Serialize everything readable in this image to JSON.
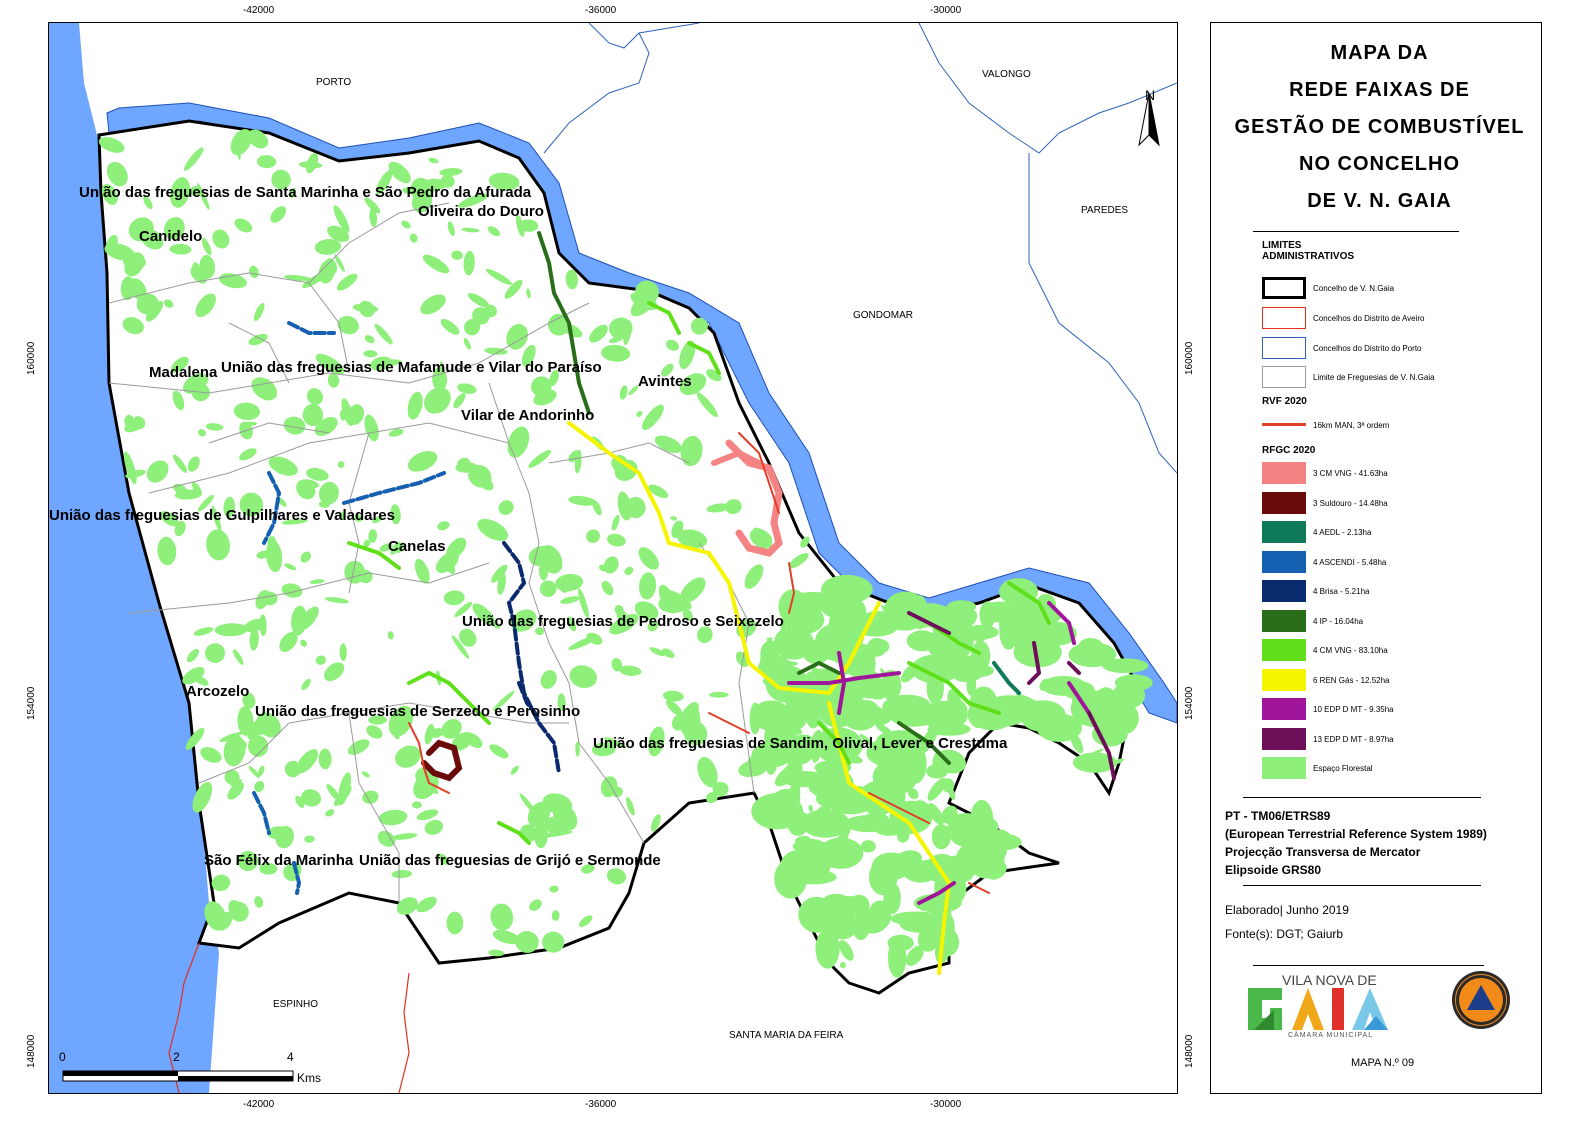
{
  "title": {
    "lines": [
      "MAPA DA",
      "REDE FAIXAS DE",
      "GESTÃO DE COMBUSTÍVEL",
      "NO CONCELHO",
      "DE V. N. GAIA"
    ]
  },
  "axes": {
    "x_ticks": [
      "-42000",
      "-36000",
      "-30000"
    ],
    "y_ticks": [
      "160000",
      "154000",
      "148000"
    ]
  },
  "north_arrow": {
    "label": "N",
    "icon": "north-arrow-icon"
  },
  "municipalities": [
    "PORTO",
    "VALONGO",
    "PAREDES",
    "GONDOMAR",
    "ESPINHO",
    "SANTA MARIA DA FEIRA"
  ],
  "parishes": [
    "União das freguesias de Santa Marinha e São Pedro da Afurada",
    "Oliveira do Douro",
    "Canidelo",
    "Madalena",
    "União das freguesias de Mafamude e Vilar do Paraíso",
    "Avintes",
    "Vilar de Andorinho",
    "União das freguesias de Gulpilhares e Valadares",
    "Canelas",
    "União das freguesias de Pedroso e Seixezelo",
    "Arcozelo",
    "União das freguesias de Serzedo e Perosinho",
    "União das freguesias de Sandim, Olival, Lever e Crestuma",
    "São Félix da Marinha",
    "União das freguesias de Grijó e Sermonde"
  ],
  "scale_bar": {
    "labels": [
      "0",
      "2",
      "4"
    ],
    "unit": "Kms"
  },
  "legend": {
    "limits_heading": "LIMITES ADMINISTRATIVOS",
    "limits": [
      {
        "label": "Concelho de V. N.Gaia",
        "border": "#000000"
      },
      {
        "label": "Concelhos do Distrito de Aveiro",
        "border": "#e0301e"
      },
      {
        "label": "Concelhos do Distrito do Porto",
        "border": "#2f63b8"
      },
      {
        "label": "Limite de Freguesias de V. N.Gaia",
        "border": "#9a9a9a"
      }
    ],
    "rvf_heading": "RVF 2020",
    "rvf": {
      "label": "16km MAN, 3ª ordem",
      "color": "#e0402a"
    },
    "rfgc_heading": "RFGC 2020",
    "rfgc": [
      {
        "label": "3 CM VNG - 41.63ha",
        "color": "#f58383"
      },
      {
        "label": "3 Suldouro - 14.48ha",
        "color": "#6b0a0a"
      },
      {
        "label": "4 AEDL - 2.13ha",
        "color": "#0f7a5a"
      },
      {
        "label": "4 ASCENDI - 5.48ha",
        "color": "#1560b0"
      },
      {
        "label": "4 Brisa - 5.21ha",
        "color": "#0a2a6e"
      },
      {
        "label": "4 IP - 16.04ha",
        "color": "#2a6e1a"
      },
      {
        "label": "4 CM VNG - 83.10ha",
        "color": "#5fe01a"
      },
      {
        "label": "6 REN Gás - 12.52ha",
        "color": "#f5f500"
      },
      {
        "label": "10 EDP D MT - 9.35ha",
        "color": "#a0159a"
      },
      {
        "label": "13 EDP D MT - 8.97ha",
        "color": "#6e0f5a"
      },
      {
        "label": "Espaço Florestal",
        "color": "#8ef07a"
      }
    ]
  },
  "projection": [
    "PT - TM06/ETRS89",
    "(European Terrestrial Reference System 1989)",
    "Projecção Transversa de Mercator",
    "Elipsoide GRS80"
  ],
  "credits": {
    "elaborated": "Elaborado| Junho 2019",
    "sources": "Fonte(s): DGT; Gaiurb"
  },
  "logo": {
    "top_text": "VILA NOVA DE",
    "word": "GAIA",
    "sub_text": "CÂMARA MUNICIPAL"
  },
  "map_number": "MAPA N.º 09",
  "colors": {
    "water": "#6fa6ff",
    "river_outline": "#1d4fb5",
    "forest": "#8ef07a",
    "boundary": "#000000"
  }
}
